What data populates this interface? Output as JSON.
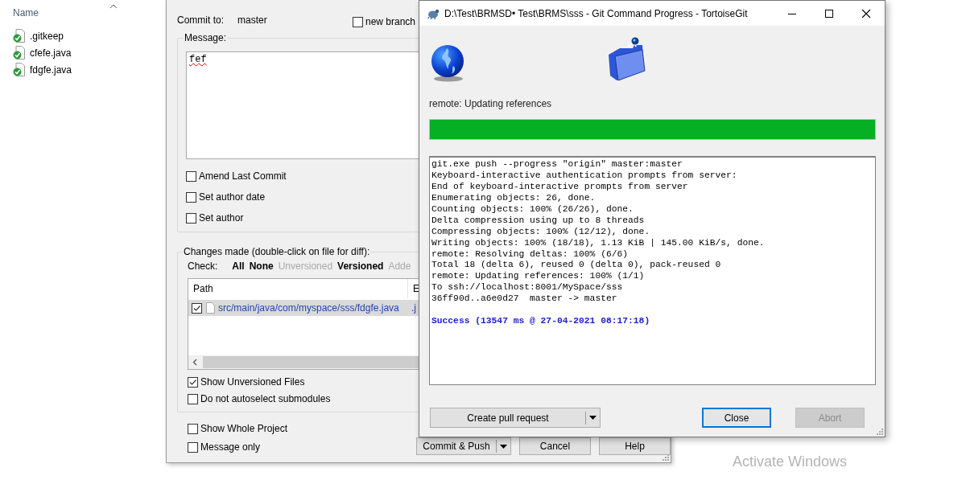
{
  "explorer": {
    "column": "Name",
    "files": [
      {
        "name": ".gitkeep"
      },
      {
        "name": "cfefe.java"
      },
      {
        "name": "fdgfe.java"
      }
    ]
  },
  "commit_dialog": {
    "commit_to_label": "Commit to:",
    "branch": "master",
    "new_branch": {
      "label": "new branch",
      "checked": false
    },
    "message_label": "Message:",
    "message": "fef",
    "message_options": [
      {
        "label": "Amend Last Commit",
        "checked": false
      },
      {
        "label": "Set author date",
        "checked": false
      },
      {
        "label": "Set author",
        "checked": false
      }
    ],
    "changes_label": "Changes made (double-click on file for diff):",
    "check_label": "Check:",
    "check_filters": [
      {
        "label": "All",
        "enabled": true
      },
      {
        "label": "None",
        "enabled": true
      },
      {
        "label": "Unversioned",
        "enabled": false
      },
      {
        "label": "Versioned",
        "enabled": true
      },
      {
        "label": "Adde",
        "enabled": false
      }
    ],
    "file_list": {
      "columns": [
        "Path",
        "E"
      ],
      "rows": [
        {
          "checked": true,
          "selected": true,
          "path": "src/main/java/com/myspace/sss/fdgfe.java",
          "ext": ".j"
        }
      ]
    },
    "list_options": [
      {
        "label": "Show Unversioned Files",
        "checked": true
      },
      {
        "label": "Do not autoselect submodules",
        "checked": false
      }
    ],
    "bottom_options": [
      {
        "label": "Show Whole Project",
        "checked": false
      },
      {
        "label": "Message only",
        "checked": false
      }
    ],
    "buttons": [
      {
        "label": "Commit & Push",
        "dropdown": true
      },
      {
        "label": "Cancel",
        "dropdown": false
      },
      {
        "label": "Help",
        "dropdown": false
      }
    ]
  },
  "progress_window": {
    "title": "D:\\Test\\BRMSD• Test\\BRMS\\sss - Git Command Progress - TortoiseGit",
    "status": "remote: Updating references",
    "progress": {
      "level": 1
    },
    "log": [
      "git.exe push --progress \"origin\" master:master",
      "Keyboard-interactive authentication prompts from server:",
      "End of keyboard-interactive prompts from server",
      "Enumerating objects: 26, done.",
      "Counting objects: 100% (26/26), done.",
      "Delta compression using up to 8 threads",
      "Compressing objects: 100% (12/12), done.",
      "Writing objects: 100% (18/18), 1.13 KiB | 145.00 KiB/s, done.",
      "remote: Resolving deltas: 100% (6/6)",
      "Total 18 (delta 6), reused 0 (delta 0), pack-reused 0",
      "remote: Updating references: 100% (1/1)",
      "To ssh://localhost:8001/MySpace/sss",
      "36ff90d..a6e0d27  master -> master"
    ],
    "result": "Success (13547 ms @ 27-04-2021 08:17:18)",
    "buttons": [
      {
        "label": "Create pull request",
        "dropdown": true,
        "focused": false,
        "disabled": false
      },
      {
        "label": "Close",
        "dropdown": false,
        "focused": true,
        "disabled": false
      },
      {
        "label": "Abort",
        "dropdown": false,
        "focused": false,
        "disabled": true
      }
    ]
  },
  "activation_notice": "Activate Windows"
}
